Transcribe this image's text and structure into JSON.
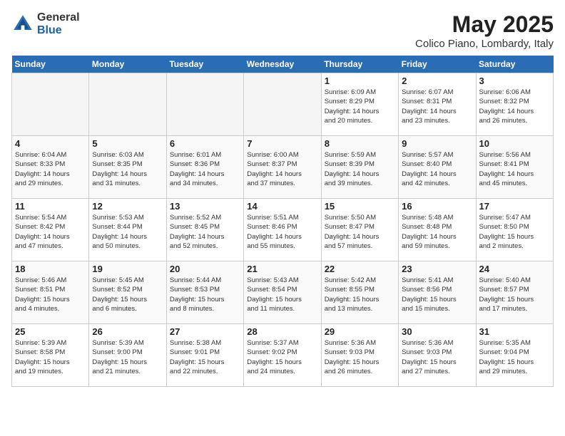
{
  "logo": {
    "general": "General",
    "blue": "Blue"
  },
  "title": {
    "month_year": "May 2025",
    "location": "Colico Piano, Lombardy, Italy"
  },
  "days_of_week": [
    "Sunday",
    "Monday",
    "Tuesday",
    "Wednesday",
    "Thursday",
    "Friday",
    "Saturday"
  ],
  "weeks": [
    [
      {
        "num": "",
        "info": ""
      },
      {
        "num": "",
        "info": ""
      },
      {
        "num": "",
        "info": ""
      },
      {
        "num": "",
        "info": ""
      },
      {
        "num": "1",
        "info": "Sunrise: 6:09 AM\nSunset: 8:29 PM\nDaylight: 14 hours\nand 20 minutes."
      },
      {
        "num": "2",
        "info": "Sunrise: 6:07 AM\nSunset: 8:31 PM\nDaylight: 14 hours\nand 23 minutes."
      },
      {
        "num": "3",
        "info": "Sunrise: 6:06 AM\nSunset: 8:32 PM\nDaylight: 14 hours\nand 26 minutes."
      }
    ],
    [
      {
        "num": "4",
        "info": "Sunrise: 6:04 AM\nSunset: 8:33 PM\nDaylight: 14 hours\nand 29 minutes."
      },
      {
        "num": "5",
        "info": "Sunrise: 6:03 AM\nSunset: 8:35 PM\nDaylight: 14 hours\nand 31 minutes."
      },
      {
        "num": "6",
        "info": "Sunrise: 6:01 AM\nSunset: 8:36 PM\nDaylight: 14 hours\nand 34 minutes."
      },
      {
        "num": "7",
        "info": "Sunrise: 6:00 AM\nSunset: 8:37 PM\nDaylight: 14 hours\nand 37 minutes."
      },
      {
        "num": "8",
        "info": "Sunrise: 5:59 AM\nSunset: 8:39 PM\nDaylight: 14 hours\nand 39 minutes."
      },
      {
        "num": "9",
        "info": "Sunrise: 5:57 AM\nSunset: 8:40 PM\nDaylight: 14 hours\nand 42 minutes."
      },
      {
        "num": "10",
        "info": "Sunrise: 5:56 AM\nSunset: 8:41 PM\nDaylight: 14 hours\nand 45 minutes."
      }
    ],
    [
      {
        "num": "11",
        "info": "Sunrise: 5:54 AM\nSunset: 8:42 PM\nDaylight: 14 hours\nand 47 minutes."
      },
      {
        "num": "12",
        "info": "Sunrise: 5:53 AM\nSunset: 8:44 PM\nDaylight: 14 hours\nand 50 minutes."
      },
      {
        "num": "13",
        "info": "Sunrise: 5:52 AM\nSunset: 8:45 PM\nDaylight: 14 hours\nand 52 minutes."
      },
      {
        "num": "14",
        "info": "Sunrise: 5:51 AM\nSunset: 8:46 PM\nDaylight: 14 hours\nand 55 minutes."
      },
      {
        "num": "15",
        "info": "Sunrise: 5:50 AM\nSunset: 8:47 PM\nDaylight: 14 hours\nand 57 minutes."
      },
      {
        "num": "16",
        "info": "Sunrise: 5:48 AM\nSunset: 8:48 PM\nDaylight: 14 hours\nand 59 minutes."
      },
      {
        "num": "17",
        "info": "Sunrise: 5:47 AM\nSunset: 8:50 PM\nDaylight: 15 hours\nand 2 minutes."
      }
    ],
    [
      {
        "num": "18",
        "info": "Sunrise: 5:46 AM\nSunset: 8:51 PM\nDaylight: 15 hours\nand 4 minutes."
      },
      {
        "num": "19",
        "info": "Sunrise: 5:45 AM\nSunset: 8:52 PM\nDaylight: 15 hours\nand 6 minutes."
      },
      {
        "num": "20",
        "info": "Sunrise: 5:44 AM\nSunset: 8:53 PM\nDaylight: 15 hours\nand 8 minutes."
      },
      {
        "num": "21",
        "info": "Sunrise: 5:43 AM\nSunset: 8:54 PM\nDaylight: 15 hours\nand 11 minutes."
      },
      {
        "num": "22",
        "info": "Sunrise: 5:42 AM\nSunset: 8:55 PM\nDaylight: 15 hours\nand 13 minutes."
      },
      {
        "num": "23",
        "info": "Sunrise: 5:41 AM\nSunset: 8:56 PM\nDaylight: 15 hours\nand 15 minutes."
      },
      {
        "num": "24",
        "info": "Sunrise: 5:40 AM\nSunset: 8:57 PM\nDaylight: 15 hours\nand 17 minutes."
      }
    ],
    [
      {
        "num": "25",
        "info": "Sunrise: 5:39 AM\nSunset: 8:58 PM\nDaylight: 15 hours\nand 19 minutes."
      },
      {
        "num": "26",
        "info": "Sunrise: 5:39 AM\nSunset: 9:00 PM\nDaylight: 15 hours\nand 21 minutes."
      },
      {
        "num": "27",
        "info": "Sunrise: 5:38 AM\nSunset: 9:01 PM\nDaylight: 15 hours\nand 22 minutes."
      },
      {
        "num": "28",
        "info": "Sunrise: 5:37 AM\nSunset: 9:02 PM\nDaylight: 15 hours\nand 24 minutes."
      },
      {
        "num": "29",
        "info": "Sunrise: 5:36 AM\nSunset: 9:03 PM\nDaylight: 15 hours\nand 26 minutes."
      },
      {
        "num": "30",
        "info": "Sunrise: 5:36 AM\nSunset: 9:03 PM\nDaylight: 15 hours\nand 27 minutes."
      },
      {
        "num": "31",
        "info": "Sunrise: 5:35 AM\nSunset: 9:04 PM\nDaylight: 15 hours\nand 29 minutes."
      }
    ]
  ]
}
